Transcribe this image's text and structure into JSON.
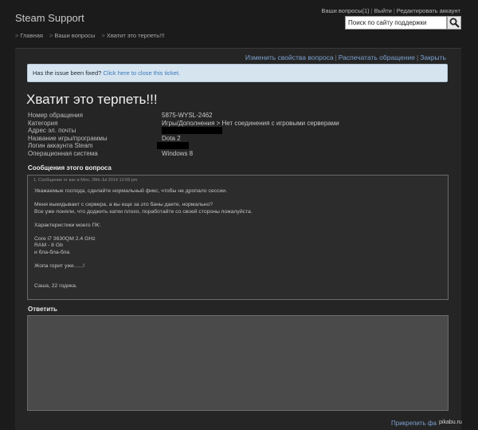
{
  "header": {
    "site_title": "Steam Support",
    "toplinks": {
      "my_questions": "Ваши вопросы(1)",
      "logout": "Выйти",
      "edit_account": "Редактировать аккаунт"
    },
    "search": {
      "placeholder": "Поиск по сайту поддержки"
    },
    "breadcrumb": [
      "Главная",
      "Ваши вопросы",
      "Хватит это терпеть!!!"
    ]
  },
  "actions": {
    "edit_properties": "Изменить свойства вопроса",
    "print": "Распечатать обращение",
    "close": "Закрыть"
  },
  "notice": {
    "question": "Has the issue been fixed?",
    "link": "Click here to close this ticket."
  },
  "ticket": {
    "title": "Хватит это терпеть!!!",
    "fields": [
      {
        "label": "Номер обращения",
        "value": "5875-WYSL-2462"
      },
      {
        "label": "Категория",
        "value": "Игры/Дополнения > Нет соединения с игровыми серверами"
      },
      {
        "label": "Адрес эл. почты",
        "value": ""
      },
      {
        "label": "Название игры/программы",
        "value": "Dota 2"
      },
      {
        "label": "Логин аккаунта Steam",
        "value": ""
      },
      {
        "label": "Операционная система",
        "value": "Windows 8"
      }
    ]
  },
  "messages": {
    "heading": "Сообщения этого вопроса",
    "items": [
      {
        "meta": "1. Сообщение от вас в Mon, 28th Jul 2014 12:09 pm",
        "paragraphs": [
          "Уважаемые господа, сделайте нормальный фикс, чтобы не дропало сессии.",
          "Меня выкидывает с сервера, а вы еще за это баны даете, нормально?",
          "Все уже поняли, что доджить катки плохо, поработайте со своей стороны пожалуйста.",
          "Характеристики моего ПК:",
          "Core i7 3630QM 2.4 GHz",
          "RAM - 8 Gb",
          "и бла-бла-бла",
          "Жопа горит уже......!",
          "Саша, 22 годика."
        ]
      }
    ]
  },
  "reply": {
    "heading": "Ответить",
    "attach": "Прикрепить фа"
  },
  "watermark": "pikabu.ru"
}
